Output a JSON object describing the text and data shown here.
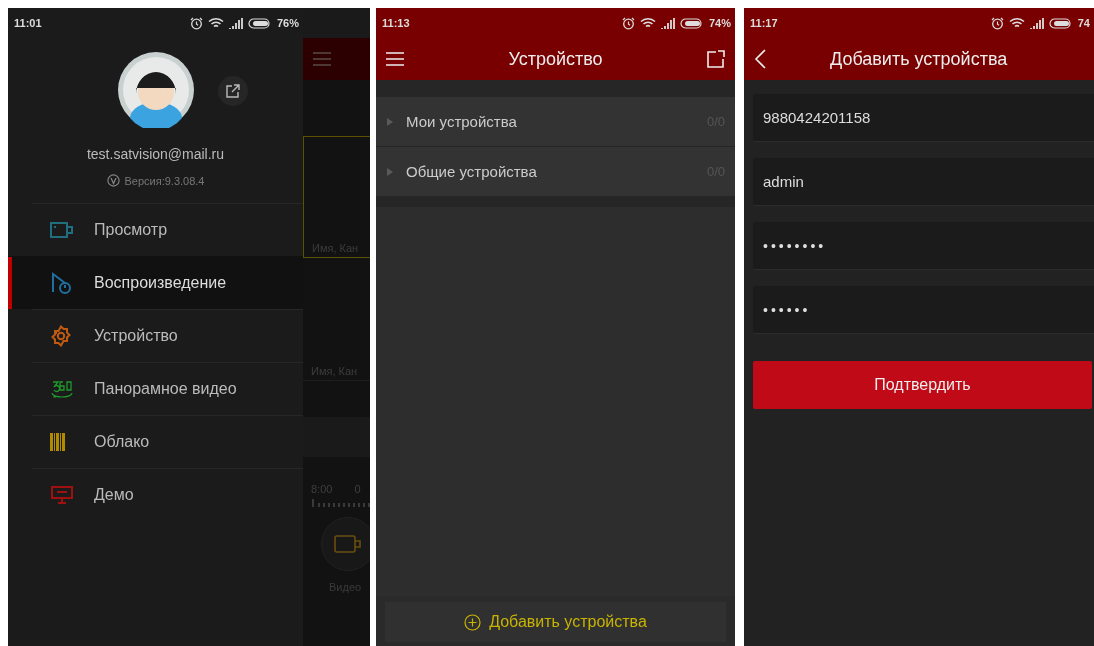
{
  "menu_screen": {
    "status_bar": {
      "time": "11:01",
      "battery": "76%"
    },
    "profile": {
      "email": "test.satvision@mail.ru",
      "version": "Версия:9.3.08.4"
    },
    "menu": [
      {
        "label": "Просмотр",
        "kind": "camera",
        "color": "#1f6f80",
        "selected": false
      },
      {
        "label": "Воспроизведение",
        "kind": "playback",
        "color": "#1f6fa0",
        "selected": true
      },
      {
        "label": "Устройство",
        "kind": "gear",
        "color": "#c05a10",
        "selected": false
      },
      {
        "label": "Панорамное видео",
        "kind": "panorama",
        "color": "#1f9a2a",
        "selected": false
      },
      {
        "label": "Облако",
        "kind": "cloud",
        "color": "#b08a00",
        "selected": false
      },
      {
        "label": "Демо",
        "kind": "demo",
        "color": "#a01010",
        "selected": false
      }
    ],
    "background": {
      "tile_captions": [
        "Имя, Кан",
        "Имя, Кан"
      ],
      "timeline": [
        "8:00",
        "0"
      ],
      "video_label": "Видео"
    }
  },
  "device_screen": {
    "status_bar": {
      "time": "11:13",
      "battery": "74%"
    },
    "title": "Устройство",
    "groups": [
      {
        "label": "Мои устройства",
        "count": "0/0",
        "expanded": false
      },
      {
        "label": "Общие устройства",
        "count": "0/0",
        "expanded": false
      }
    ],
    "add_button": "Добавить устройства"
  },
  "add_screen": {
    "status_bar": {
      "time": "11:17",
      "battery": "74"
    },
    "title": "Добавить устройства",
    "fields": [
      {
        "value": "9880424201158",
        "kind": "text"
      },
      {
        "value": "admin",
        "kind": "text"
      },
      {
        "value": "••••••••",
        "kind": "password"
      },
      {
        "value": "••••••",
        "kind": "password"
      }
    ],
    "confirm_button": "Подтвердить"
  }
}
